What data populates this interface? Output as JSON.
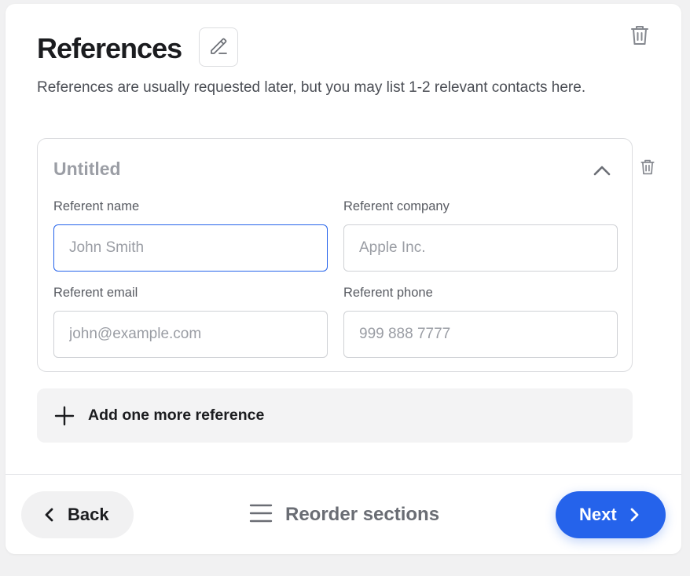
{
  "section": {
    "title": "References",
    "description": "References are usually requested later, but you may list 1-2 relevant contacts here."
  },
  "reference": {
    "title": "Untitled",
    "fields": {
      "name": {
        "label": "Referent name",
        "placeholder": "John Smith",
        "value": ""
      },
      "company": {
        "label": "Referent company",
        "placeholder": "Apple Inc.",
        "value": ""
      },
      "email": {
        "label": "Referent email",
        "placeholder": "john@example.com",
        "value": ""
      },
      "phone": {
        "label": "Referent phone",
        "placeholder": "999 888 7777",
        "value": ""
      }
    }
  },
  "add_reference_label": "Add one more reference",
  "footer": {
    "back_label": "Back",
    "reorder_label": "Reorder sections",
    "next_label": "Next"
  },
  "icons": {
    "edit": "pencil-icon",
    "delete": "trash-icon",
    "collapse": "chevron-up-icon",
    "add": "plus-icon",
    "back": "chevron-left-icon",
    "reorder": "hamburger-icon",
    "next": "chevron-right-icon"
  },
  "colors": {
    "accent": "#2563eb",
    "background": "#f1f1f2",
    "card": "#ffffff"
  }
}
